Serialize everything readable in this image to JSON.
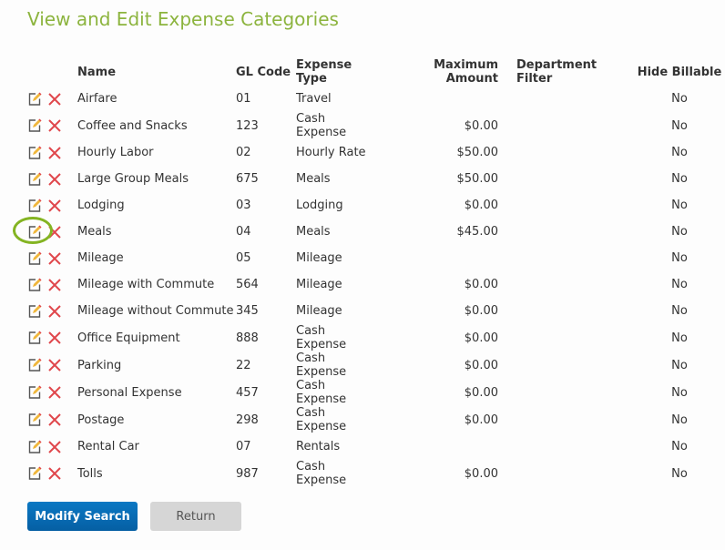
{
  "title": "View and Edit Expense Categories",
  "headers": {
    "name": "Name",
    "gl": "GL Code",
    "type": "Expense Type",
    "max": "Maximum Amount",
    "dept": "Department Filter",
    "hide": "Hide Billable"
  },
  "rows": [
    {
      "name": "Airfare",
      "gl": "01",
      "type": "Travel",
      "max": "",
      "dept": "",
      "hide": "No"
    },
    {
      "name": "Coffee and Snacks",
      "gl": "123",
      "type": "Cash Expense",
      "max": "$0.00",
      "dept": "",
      "hide": "No"
    },
    {
      "name": "Hourly Labor",
      "gl": "02",
      "type": "Hourly Rate",
      "max": "$50.00",
      "dept": "",
      "hide": "No"
    },
    {
      "name": "Large Group Meals",
      "gl": "675",
      "type": "Meals",
      "max": "$50.00",
      "dept": "",
      "hide": "No"
    },
    {
      "name": "Lodging",
      "gl": "03",
      "type": "Lodging",
      "max": "$0.00",
      "dept": "",
      "hide": "No"
    },
    {
      "name": "Meals",
      "gl": "04",
      "type": "Meals",
      "max": "$45.00",
      "dept": "",
      "hide": "No",
      "highlighted": true
    },
    {
      "name": "Mileage",
      "gl": "05",
      "type": "Mileage",
      "max": "",
      "dept": "",
      "hide": "No"
    },
    {
      "name": "Mileage with Commute",
      "gl": "564",
      "type": "Mileage",
      "max": "$0.00",
      "dept": "",
      "hide": "No"
    },
    {
      "name": "Mileage without Commute",
      "gl": "345",
      "type": "Mileage",
      "max": "$0.00",
      "dept": "",
      "hide": "No"
    },
    {
      "name": "Office Equipment",
      "gl": "888",
      "type": "Cash Expense",
      "max": "$0.00",
      "dept": "",
      "hide": "No"
    },
    {
      "name": "Parking",
      "gl": "22",
      "type": "Cash Expense",
      "max": "$0.00",
      "dept": "",
      "hide": "No"
    },
    {
      "name": "Personal Expense",
      "gl": "457",
      "type": "Cash Expense",
      "max": "$0.00",
      "dept": "",
      "hide": "No"
    },
    {
      "name": "Postage",
      "gl": "298",
      "type": "Cash Expense",
      "max": "$0.00",
      "dept": "",
      "hide": "No"
    },
    {
      "name": "Rental Car",
      "gl": "07",
      "type": "Rentals",
      "max": "",
      "dept": "",
      "hide": "No"
    },
    {
      "name": "Tolls",
      "gl": "987",
      "type": "Cash Expense",
      "max": "$0.00",
      "dept": "",
      "hide": "No"
    }
  ],
  "buttons": {
    "modify": "Modify Search",
    "return": "Return"
  },
  "colors": {
    "accent": "#8cb43e",
    "primary": "#0b6db5",
    "delete": "#e0474c"
  }
}
